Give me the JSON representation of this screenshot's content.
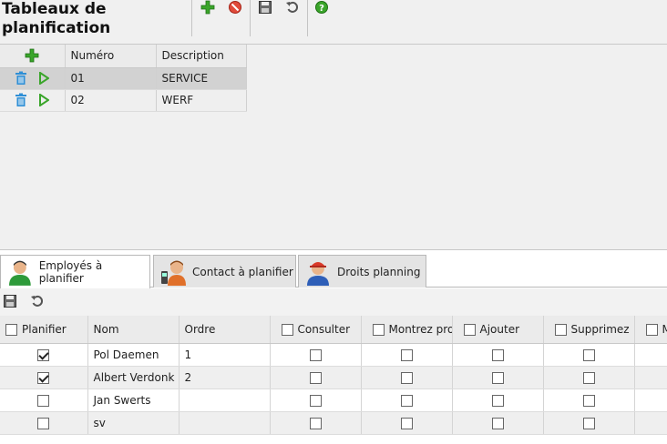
{
  "header": {
    "title": "Tableaux de planification",
    "toolbar_icons": [
      "add-icon",
      "delete-icon",
      "save-icon",
      "undo-icon",
      "help-icon"
    ]
  },
  "grid1": {
    "columns": [
      "Numéro",
      "Description"
    ],
    "rows": [
      {
        "numero": "01",
        "description": "SERVICE"
      },
      {
        "numero": "02",
        "description": "WERF"
      }
    ]
  },
  "tabs": [
    {
      "label": "Employés à planifier",
      "icon": "employee-avatar-icon"
    },
    {
      "label": "Contact à planifier",
      "icon": "contact-avatar-icon"
    },
    {
      "label": "Droits planning",
      "icon": "rights-avatar-icon"
    }
  ],
  "grid2": {
    "columns": [
      "Planifier",
      "Nom",
      "Ordre",
      "Consulter",
      "Montrez prop",
      "Ajouter",
      "Supprimez",
      "M"
    ],
    "rows": [
      {
        "planifier": true,
        "nom": "Pol Daemen",
        "ordre": "1"
      },
      {
        "planifier": true,
        "nom": "Albert Verdonk",
        "ordre": "2"
      },
      {
        "planifier": false,
        "nom": "Jan Swerts",
        "ordre": ""
      },
      {
        "planifier": false,
        "nom": "sv",
        "ordre": ""
      }
    ]
  },
  "colors": {
    "accent_green": "#3aa52a",
    "delete_red": "#d93a2b",
    "trash_blue": "#2f8fd6"
  }
}
